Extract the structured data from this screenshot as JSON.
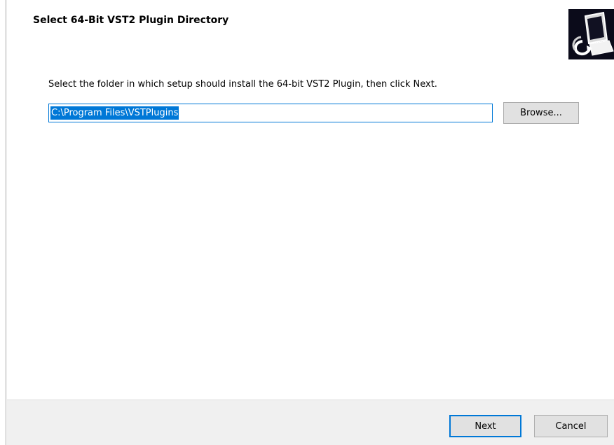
{
  "header": {
    "title": "Select 64-Bit VST2 Plugin Directory",
    "wizard_image_icon": "setup-computer-icon"
  },
  "main": {
    "instruction": "Select the folder in which setup should install the 64-bit VST2 Plugin, then click Next.",
    "directory_value": "C:\\Program Files\\VSTPlugins",
    "browse_label": "Browse..."
  },
  "footer": {
    "next_label": "Next",
    "cancel_label": "Cancel"
  },
  "colors": {
    "accent": "#0078d7",
    "button_face": "#e1e1e1",
    "footer_bg": "#f0f0f0",
    "wizard_image_bg": "#0b0b1a"
  }
}
